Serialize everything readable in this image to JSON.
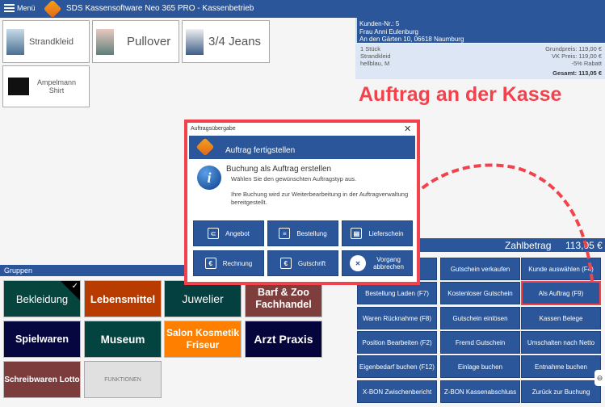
{
  "titlebar": {
    "menu_label": "Menü",
    "title": "SDS Kassensoftware Neo 365 PRO - Kassenbetrieb"
  },
  "articles": [
    {
      "label": "Strandkleid"
    },
    {
      "label": "Pullover"
    },
    {
      "label": "3/4 Jeans"
    },
    {
      "label": "Ampelmann Shirt"
    }
  ],
  "customer": {
    "number": "Kunden-Nr.: 5",
    "name": "Frau Anni Eulenburg",
    "address": "An den Gärten 10, 06618 Naumburg"
  },
  "cart_item": {
    "qty": "1 Stück",
    "name": "Strandkleid",
    "variant": "hellblau, M",
    "base_price": "Grundpreis: 119,00 €",
    "sale_price": "VK Preis: 119,00 €",
    "discount": "-5% Rabatt",
    "total": "Gesamt: 113,05 €"
  },
  "annotation": {
    "text": "Auftrag an der Kasse",
    "color": "#f2424c"
  },
  "groups": {
    "header": "Gruppen",
    "items": [
      {
        "label": "Bekleidung",
        "color": "#06443e",
        "selected": true
      },
      {
        "label": "Lebensmittel",
        "color": "#b83c00"
      },
      {
        "label": "Juwelier",
        "color": "#03403f"
      },
      {
        "label": "Barf & Zoo Fachhandel",
        "color": "#7e3e3c"
      },
      {
        "label": "Spielwaren",
        "color": "#07073f"
      },
      {
        "label": "Museum",
        "color": "#044440"
      },
      {
        "label": "Salon Kosmetik Friseur",
        "color": "#ff8000"
      },
      {
        "label": "Arzt Praxis",
        "color": "#05053c"
      },
      {
        "label": "Schreibwaren Lotto",
        "color": "#7c3c3c"
      },
      {
        "label": "FUNKTIONEN",
        "color": "#e0e0e0"
      }
    ]
  },
  "payment": {
    "label": "Zahlbetrag",
    "amount": "113,05 €"
  },
  "functions": [
    "(F6)",
    "Gutschein verkaufen",
    "Kunde auswählen (F4)",
    "Bestellung Laden (F7)",
    "Kostenloser Gutschein",
    "Als Auftrag (F9)",
    "Waren Rücknahme (F8)",
    "Gutschein einlösen",
    "Kassen Belege",
    "Position Bearbeiten (F2)",
    "Fremd Gutschein",
    "Umschalten nach Netto",
    "Eigenbedarf buchen (F12)",
    "Einlage buchen",
    "Entnahme buchen",
    "X-BON Zwischenbericht",
    "Z-BON Kassenabschluss",
    "Zurück zur Buchung"
  ],
  "dialog": {
    "window_title": "Auftragsübergabe",
    "close": "✕",
    "header": "Auftrag fertigstellen",
    "heading": "Buchung als Auftrag erstellen",
    "line1": "Wählen Sie den gewünschten Auftragstyp aus.",
    "line2": "Ihre Buchung wird zur Weiterbearbeitung in der Auftragverwaltung bereitgestellt.",
    "buttons": [
      {
        "label": "Angebot",
        "icon": "tag-icon"
      },
      {
        "label": "Bestellung",
        "icon": "order-document-icon"
      },
      {
        "label": "Lieferschein",
        "icon": "clipboard-icon"
      },
      {
        "label": "Rechnung",
        "icon": "euro-invoice-icon"
      },
      {
        "label": "Gutschrift",
        "icon": "euro-credit-icon"
      },
      {
        "label": "Vorgang abbrechen",
        "icon": "cancel-circle-icon"
      }
    ]
  }
}
